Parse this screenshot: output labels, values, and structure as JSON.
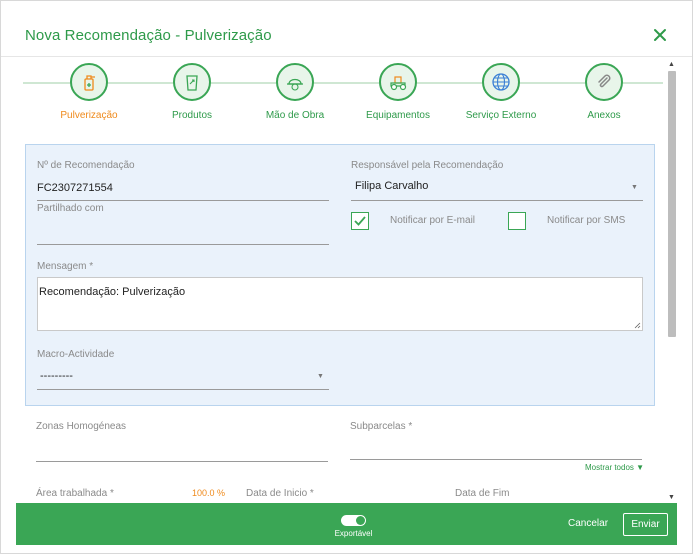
{
  "header": {
    "title": "Nova Recomendação - Pulverização"
  },
  "steps": [
    {
      "label": "Pulverização",
      "icon": "sprayer-icon",
      "active": true
    },
    {
      "label": "Produtos",
      "icon": "product-bag-icon",
      "active": false
    },
    {
      "label": "Mão de Obra",
      "icon": "worker-hat-icon",
      "active": false
    },
    {
      "label": "Equipamentos",
      "icon": "tractor-icon",
      "active": false
    },
    {
      "label": "Serviço Externo",
      "icon": "globe-icon",
      "active": false
    },
    {
      "label": "Anexos",
      "icon": "paperclip-icon",
      "active": false
    }
  ],
  "form": {
    "recommendation_no_label": "Nº de Recomendação",
    "recommendation_no_value": "FC2307271554",
    "responsible_label": "Responsável pela Recomendação",
    "responsible_value": "Filipa Carvalho",
    "shared_label": "Partilhado com",
    "notify_email_label": "Notificar por E-mail",
    "notify_email_checked": true,
    "notify_sms_label": "Notificar por SMS",
    "notify_sms_checked": false,
    "message_label": "Mensagem *",
    "message_value": "Recomendação: Pulverização",
    "macro_label": "Macro-Actividade",
    "macro_value": "---------"
  },
  "lower": {
    "zones_label": "Zonas Homogéneas",
    "subparcels_label": "Subparcelas *",
    "show_all": "Mostrar todos ▼",
    "area_label": "Área trabalhada *",
    "area_pct": "100.0 %",
    "start_label": "Data de Inicio *",
    "end_label": "Data de Fim"
  },
  "footer": {
    "export_label": "Exportável",
    "export_on": true,
    "cancel_label": "Cancelar",
    "send_label": "Enviar"
  },
  "colors": {
    "brand_green": "#3aa655",
    "accent_orange": "#ef8a1c",
    "panel_bg": "#eaf2fb"
  }
}
